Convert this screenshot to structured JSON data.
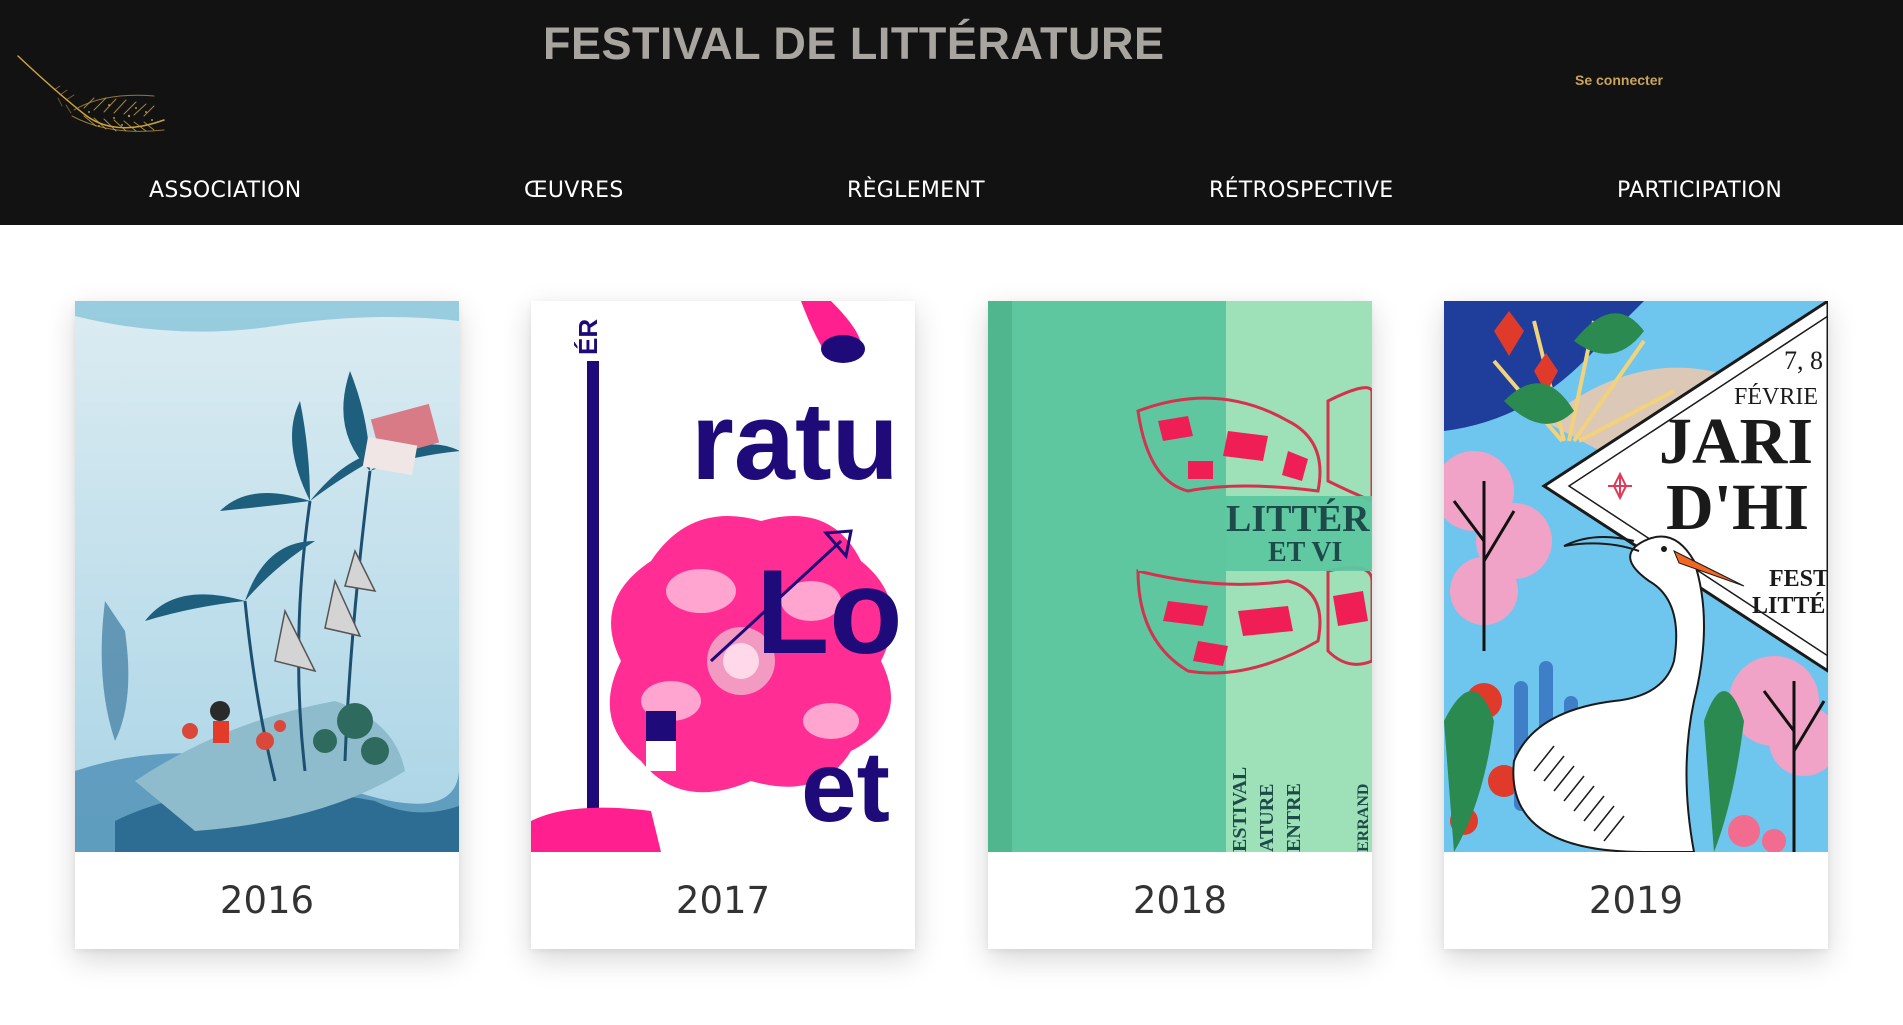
{
  "header": {
    "site_title": "FESTIVAL DE LITTÉRATURE",
    "login_label": "Se connecter",
    "logo_icon": "golden-feather-icon",
    "background_color": "#121212",
    "title_color": "#a8a4a0",
    "login_color": "#c9a45a"
  },
  "nav": {
    "items": [
      {
        "label": "ASSOCIATION"
      },
      {
        "label": "ŒUVRES"
      },
      {
        "label": "RÈGLEMENT"
      },
      {
        "label": "RÉTROSPECTIVE"
      },
      {
        "label": "PARTICIPATION"
      }
    ]
  },
  "editions": [
    {
      "year": "2016",
      "poster_text": []
    },
    {
      "year": "2017",
      "poster_text": [
        "ÉR",
        "ratu",
        "Lo",
        "et"
      ]
    },
    {
      "year": "2018",
      "poster_text": [
        "LITTÉR",
        "ET VI",
        "ESTIVAL",
        "ATURE",
        "ENTRE",
        "ERRAND"
      ]
    },
    {
      "year": "2019",
      "poster_text": [
        "7, 8",
        "FÉVRIE",
        "JARI",
        "D'HI",
        "FEST",
        "LITTÉ"
      ]
    }
  ],
  "colors": {
    "accent_pink": "#ff1f8e",
    "accent_navy": "#1e0a78",
    "mint": "#5ec7a0",
    "light_mint": "#9ee0b8",
    "heron_beak": "#f26722",
    "sky": "#6ec6ee"
  }
}
